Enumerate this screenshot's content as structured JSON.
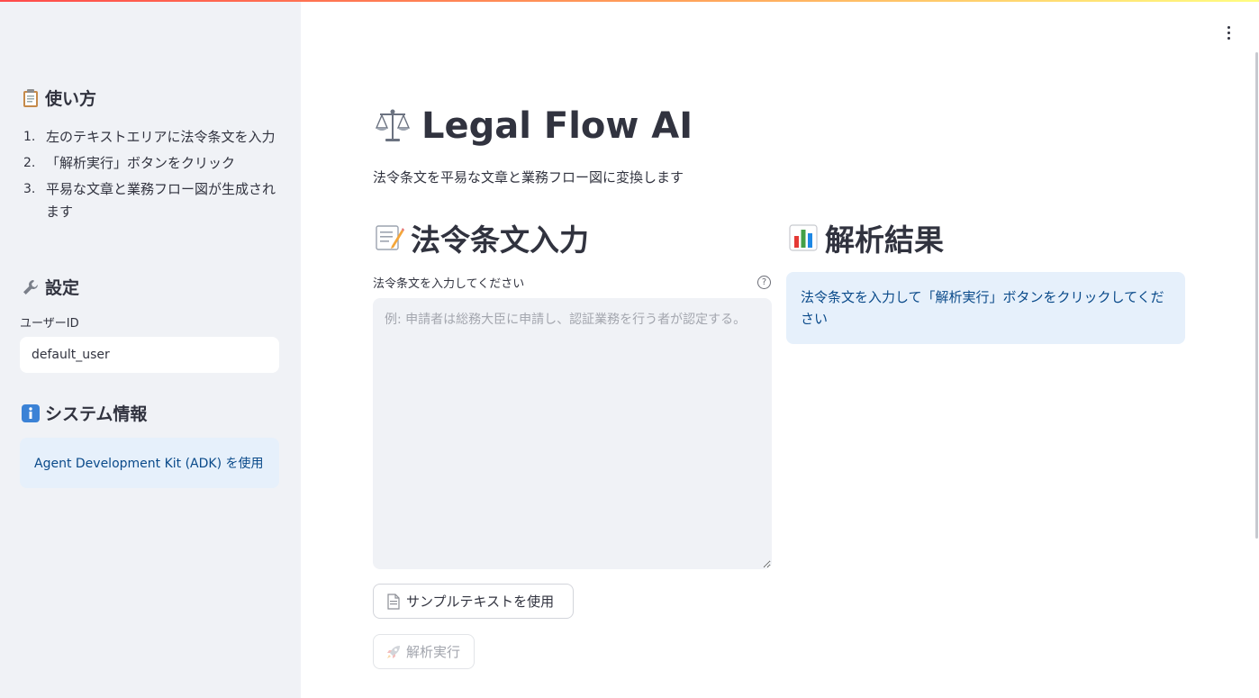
{
  "sidebar": {
    "how_to": {
      "icon": "clipboard-icon",
      "title": "使い方",
      "steps": [
        {
          "num": "1.",
          "text": "左のテキストエリアに法令条文を入力"
        },
        {
          "num": "2.",
          "text": "「解析実行」ボタンをクリック"
        },
        {
          "num": "3.",
          "text": "平易な文章と業務フロー図が生成されます"
        }
      ]
    },
    "settings": {
      "icon": "wrench-icon",
      "title": "設定",
      "user_id_label": "ユーザーID",
      "user_id_value": "default_user"
    },
    "system_info": {
      "icon": "info-icon",
      "title": "システム情報",
      "message": "Agent Development Kit (ADK) を使用"
    }
  },
  "main": {
    "title_icon": "balance-scale-icon",
    "title": "Legal Flow AI",
    "subtitle": "法令条文を平易な文章と業務フロー図に変換します",
    "input_section": {
      "icon": "memo-icon",
      "title": "法令条文入力",
      "textarea_label": "法令条文を入力してください",
      "help_glyph": "?",
      "textarea_placeholder": "例: 申請者は総務大臣に申請し、認証業務を行う者が認定する。",
      "textarea_value": "",
      "sample_button_label": "サンプルテキストを使用",
      "run_button_label": "解析実行"
    },
    "result_section": {
      "icon": "bar-chart-icon",
      "title": "解析結果",
      "message": "法令条文を入力して「解析実行」ボタンをクリックしてください"
    }
  },
  "colors": {
    "sidebar_bg": "#f0f2f6",
    "info_bg": "#e6f0fb",
    "info_text": "#0a4a8a",
    "text": "#31333f",
    "accent_gradient_start": "#ff4b4b",
    "accent_gradient_end": "#fffd80"
  }
}
